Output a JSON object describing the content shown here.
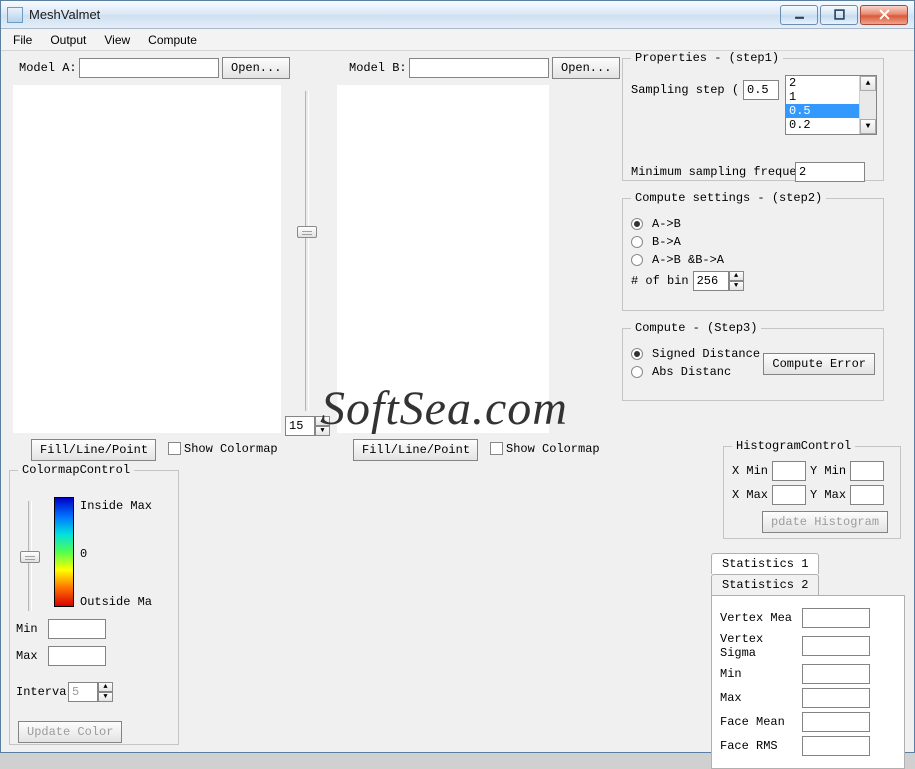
{
  "window": {
    "title": "MeshValmet"
  },
  "menu": {
    "file": "File",
    "output": "Output",
    "view": "View",
    "compute": "Compute"
  },
  "model_a": {
    "label": "Model A:",
    "value": "",
    "open": "Open..."
  },
  "model_b": {
    "label": "Model B:",
    "value": "",
    "open": "Open..."
  },
  "slider_value": "15",
  "fill_btn": "Fill/Line/Point",
  "show_colormap": "Show Colormap",
  "properties": {
    "legend": "Properties - (step1)",
    "sampling_step": "Sampling step (",
    "sampling_value": "0.5",
    "list": [
      "2",
      "1",
      "0.5",
      "0.2"
    ],
    "list_sel": 2,
    "min_freq": "Minimum sampling frequenc",
    "min_freq_value": "2"
  },
  "compute_settings": {
    "legend": "Compute settings - (step2)",
    "opt_ab": "A->B",
    "opt_ba": "B->A",
    "opt_both": "A->B &B->A",
    "bins_label": "# of bin",
    "bins_value": "256"
  },
  "compute": {
    "legend": "Compute - (Step3)",
    "signed": "Signed Distance",
    "abs": "Abs Distanc",
    "btn": "Compute Error"
  },
  "colormap": {
    "legend": "ColormapControl",
    "inside": "Inside Max",
    "zero": "0",
    "outside": "Outside Ma",
    "min": "Min",
    "max": "Max",
    "interv": "Interva",
    "interv_value": "5",
    "update": "Update Color"
  },
  "histogram": {
    "legend": "HistogramControl",
    "xmin": "X Min",
    "ymin": "Y Min",
    "xmax": "X Max",
    "ymax": "Y Max",
    "btn": "pdate Histogram"
  },
  "stats": {
    "tab1": "Statistics 1",
    "tab2": "Statistics 2",
    "vertex_mea": "Vertex Mea",
    "vertex_sig": "Vertex Sigma",
    "min": "Min",
    "max": "Max",
    "face_mean": "Face Mean",
    "face_rms": "Face RMS"
  },
  "watermark": "SoftSea.com"
}
